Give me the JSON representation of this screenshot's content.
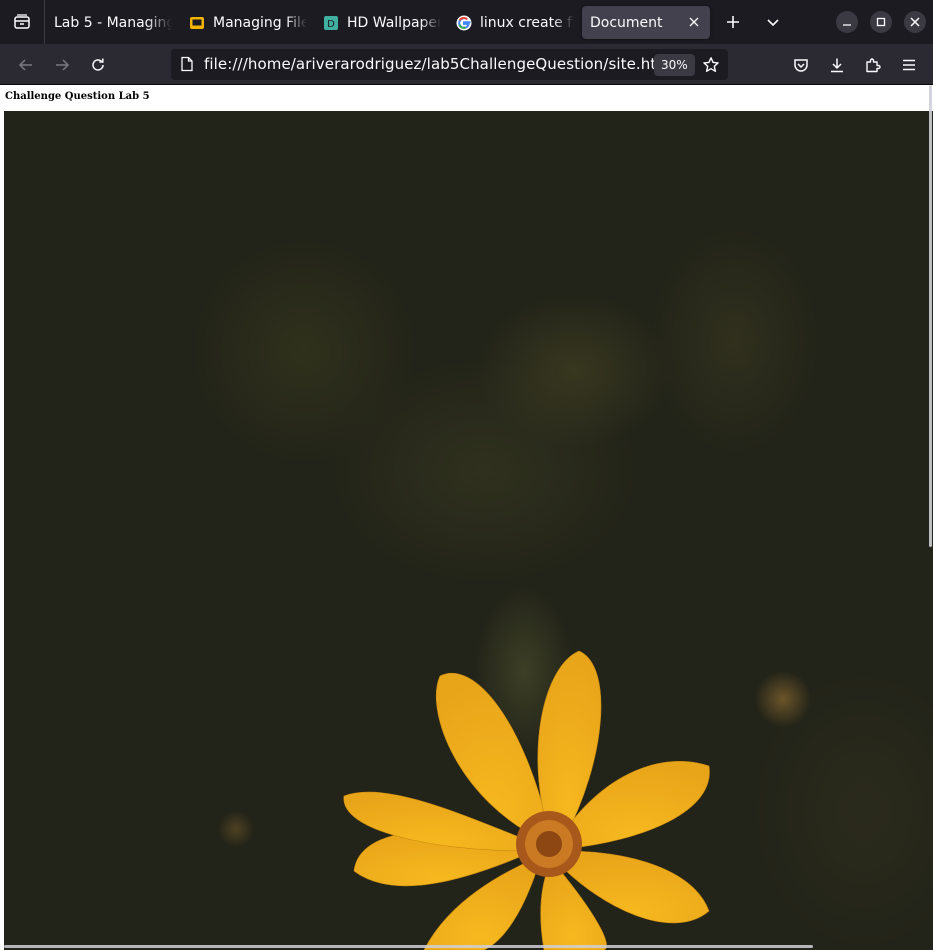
{
  "browser": {
    "tabs": [
      {
        "label": "Lab 5 - Managing",
        "favicon": "none-icon"
      },
      {
        "label": "Managing File",
        "favicon": "slides-icon"
      },
      {
        "label": "HD Wallpaper",
        "favicon": "wallpaper-site-icon"
      },
      {
        "label": "linux create fi",
        "favicon": "google-icon"
      },
      {
        "label": "Document",
        "favicon": "none-icon",
        "active": true
      }
    ],
    "url": "file:///home/ariverarodriguez/lab5ChallengeQuestion/site.html",
    "zoom": "30%"
  },
  "page": {
    "heading": "Challenge Question Lab 5"
  },
  "colors": {
    "toolbar_bg": "#2b2a33",
    "tabstrip_bg": "#1c1b22",
    "flower_yellow": "#f0b020",
    "flower_center": "#b5651d"
  }
}
